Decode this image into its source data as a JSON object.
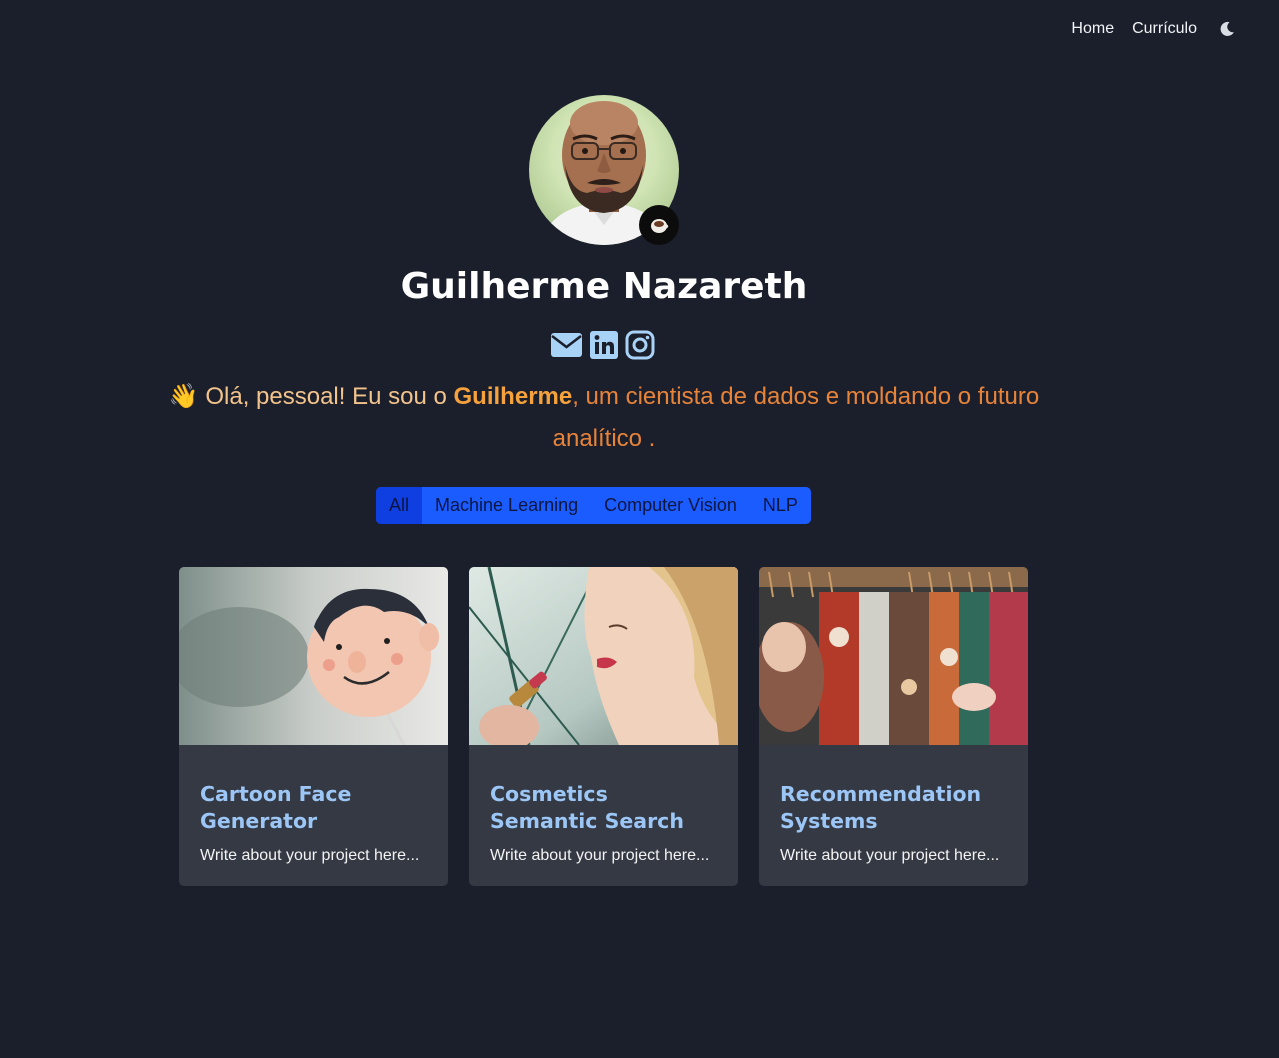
{
  "nav": {
    "home": "Home",
    "curriculo": "Currículo",
    "theme_toggle_icon": "moon-icon"
  },
  "profile": {
    "name": "Guilherme Nazareth",
    "badge_icon": "coffee-icon",
    "social_icons": [
      "envelope-icon",
      "linkedin-icon",
      "instagram-icon"
    ]
  },
  "intro": {
    "wave": "👋",
    "lead": "Olá, pessoal! Eu sou o",
    "name": "Guilherme",
    "tail": ", um cientista de dados e moldando o futuro analítico ."
  },
  "filters": {
    "items": [
      "All",
      "Machine Learning",
      "Computer Vision",
      "NLP"
    ],
    "active": "All"
  },
  "projects": [
    {
      "title": "Cartoon Face Generator",
      "description": "Write about your project here..."
    },
    {
      "title": "Cosmetics Semantic Search",
      "description": "Write about your project here..."
    },
    {
      "title": "Recommendation Systems",
      "description": "Write about your project here..."
    }
  ],
  "colors": {
    "background": "#1b1f2b",
    "card": "#343944",
    "card_title": "#9cc6f5",
    "accent_orange": "#e8843a",
    "filter_blue": "#1a5cff",
    "social_icon": "#a9d2f7"
  }
}
